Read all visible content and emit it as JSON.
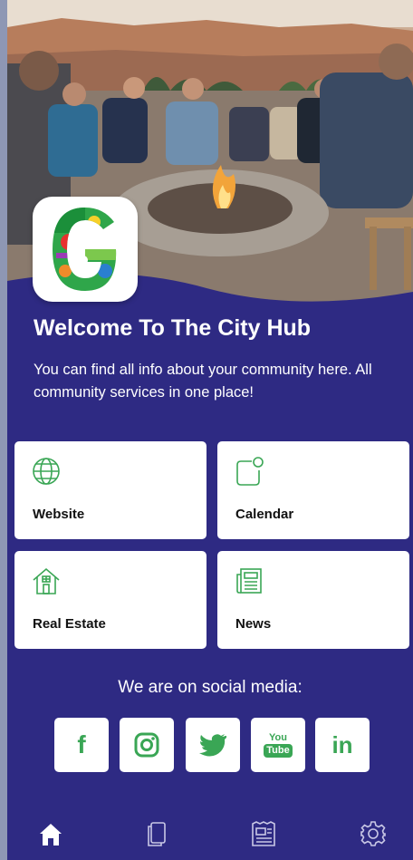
{
  "header": {
    "title": "Welcome To The City Hub",
    "subtitle": "You can find all info about your community here. All community services in one place!",
    "logo_letter": "G"
  },
  "tiles": [
    {
      "label": "Website",
      "icon": "globe-icon"
    },
    {
      "label": "Calendar",
      "icon": "calendar-icon"
    },
    {
      "label": "Real Estate",
      "icon": "house-icon"
    },
    {
      "label": "News",
      "icon": "newspaper-icon"
    }
  ],
  "social": {
    "heading": "We are on social media:",
    "networks": [
      {
        "name": "facebook",
        "icon": "facebook-icon"
      },
      {
        "name": "instagram",
        "icon": "instagram-icon"
      },
      {
        "name": "twitter",
        "icon": "twitter-icon"
      },
      {
        "name": "youtube",
        "icon": "youtube-icon",
        "glyph_top": "You",
        "glyph_bottom": "Tube"
      },
      {
        "name": "linkedin",
        "icon": "linkedin-icon",
        "glyph": "in"
      }
    ],
    "facebook_glyph": "f"
  },
  "tabbar": [
    {
      "name": "home",
      "icon": "home-icon",
      "active": true
    },
    {
      "name": "pages",
      "icon": "pages-icon",
      "active": false
    },
    {
      "name": "news",
      "icon": "news-icon",
      "active": false
    },
    {
      "name": "settings",
      "icon": "gear-icon",
      "active": false
    }
  ],
  "colors": {
    "background": "#2e2a83",
    "accent": "#3aa655",
    "card": "#ffffff",
    "tab_active": "#ffffff",
    "tab_inactive": "#c9c8e6"
  }
}
